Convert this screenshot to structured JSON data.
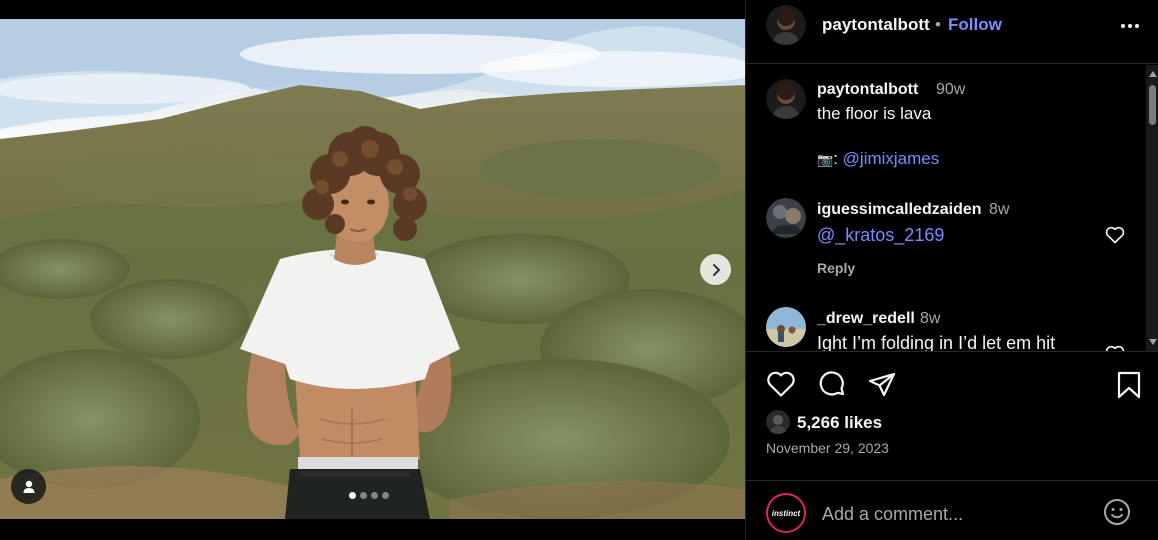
{
  "post": {
    "username": "paytontalbott",
    "follow_dot": "•",
    "follow_label": "Follow",
    "more_icon": "more-horizontal-icon"
  },
  "media": {
    "carousel_dots": 4,
    "active_dot": 0,
    "next_icon": "chevron-right-icon",
    "tag_icon": "person-icon"
  },
  "caption": {
    "username": "paytontalbott",
    "time": "90w",
    "line1": "the floor is lava",
    "camera_emoji": "📷",
    "separator": ":",
    "credit": "@jimixjames"
  },
  "comments": [
    {
      "username": "iguessimcalledzaiden",
      "time": "8w",
      "text": "@_kratos_2169",
      "is_mention": true,
      "reply_label": "Reply"
    },
    {
      "username": "_drew_redell",
      "time": "8w",
      "text": "Ight I’m folding in I’d let em hit",
      "is_mention": false
    }
  ],
  "actions": {
    "like_icon": "heart-icon",
    "comment_icon": "comment-icon",
    "share_icon": "send-icon",
    "save_icon": "bookmark-icon"
  },
  "stats": {
    "likes": "5,266 likes",
    "date": "November 29, 2023"
  },
  "composer": {
    "avatar_text": "instinct",
    "placeholder": "Add a comment...",
    "emoji_icon": "smiley-icon"
  },
  "colors": {
    "background": "#000000",
    "link": "#7b8cff",
    "muted": "#a8a8a8",
    "text": "#f5f5f5",
    "divider": "#262626"
  }
}
